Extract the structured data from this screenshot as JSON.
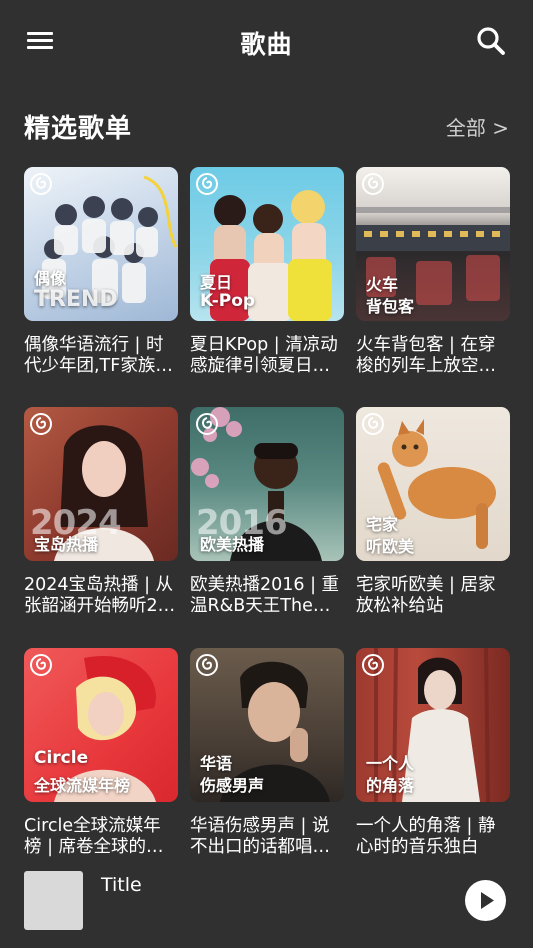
{
  "app": {
    "title": "歌曲"
  },
  "section": {
    "title": "精选歌单",
    "all_label": "全部 >"
  },
  "playlists": [
    {
      "title": "偶像华语流行 | 时代少年团,TF家族…",
      "tag1": "偶像",
      "tag2": "TREND",
      "big": ""
    },
    {
      "title": "夏日KPop | 清凉动感旋律引领夏日心…",
      "tag1": "夏日",
      "tag2": "K-Pop",
      "big": ""
    },
    {
      "title": "火车背包客 | 在穿梭的列车上放空思…",
      "tag1": "火车",
      "tag2": "背包客",
      "big": ""
    },
    {
      "title": "2024宝岛热播 | 从张韶涵开始畅听2…",
      "tag1": "",
      "tag2": "宝岛热播",
      "big": "2024"
    },
    {
      "title": "欧美热播2016 | 重温R&B天王The W…",
      "tag1": "",
      "tag2": "欧美热播",
      "big": "2016"
    },
    {
      "title": "宅家听欧美 | 居家放松补给站",
      "tag1": "宅家",
      "tag2": "听欧美",
      "big": ""
    },
    {
      "title": "Circle全球流媒年榜 | 席卷全球的中毒…",
      "tag1": "Circle",
      "tag2": "全球流媒年榜",
      "big": ""
    },
    {
      "title": "华语伤感男声 | 说不出口的话都唱给…",
      "tag1": "华语",
      "tag2": "伤感男声",
      "big": ""
    },
    {
      "title": "一个人的角落 | 静心时的音乐独白",
      "tag1": "一个人",
      "tag2": "的角落",
      "big": ""
    }
  ],
  "player": {
    "title": "Title"
  },
  "icons": {
    "menu": "menu-icon",
    "search": "search-icon",
    "play": "play-icon",
    "brand": "netease-logo-icon"
  },
  "colors": {
    "background": "#303030",
    "text": "#ffffff",
    "muted": "#cfcfcf"
  }
}
